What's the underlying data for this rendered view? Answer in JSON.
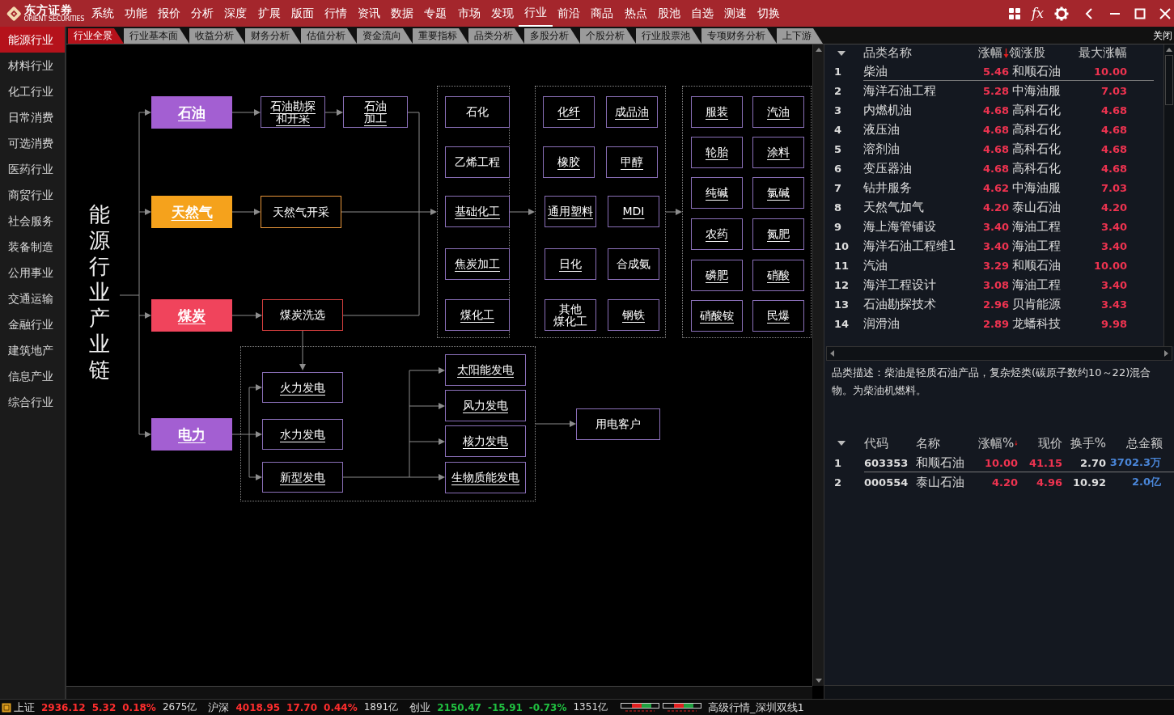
{
  "app": {
    "brand": "东方证券",
    "brand_en": "ORIENT SECURITIES"
  },
  "menu": [
    {
      "label": "系统",
      "selected": false
    },
    {
      "label": "功能",
      "selected": false
    },
    {
      "label": "报价",
      "selected": false
    },
    {
      "label": "分析",
      "selected": false
    },
    {
      "label": "深度",
      "selected": false
    },
    {
      "label": "扩展",
      "selected": false
    },
    {
      "label": "版面",
      "selected": false
    },
    {
      "label": "行情",
      "selected": false
    },
    {
      "label": "资讯",
      "selected": false
    },
    {
      "label": "数据",
      "selected": false
    },
    {
      "label": "专题",
      "selected": false
    },
    {
      "label": "市场",
      "selected": false
    },
    {
      "label": "发现",
      "selected": false
    },
    {
      "label": "行业",
      "selected": true
    },
    {
      "label": "前沿",
      "selected": false
    },
    {
      "label": "商品",
      "selected": false
    },
    {
      "label": "热点",
      "selected": false
    },
    {
      "label": "股池",
      "selected": false
    },
    {
      "label": "自选",
      "selected": false
    },
    {
      "label": "测速",
      "selected": false
    },
    {
      "label": "切换",
      "selected": false
    }
  ],
  "toolbar": {
    "formula_label": "fx"
  },
  "sidebar": {
    "items": [
      {
        "label": "能源行业",
        "selected": true
      },
      {
        "label": "材料行业",
        "selected": false
      },
      {
        "label": "化工行业",
        "selected": false
      },
      {
        "label": "日常消费",
        "selected": false
      },
      {
        "label": "可选消费",
        "selected": false
      },
      {
        "label": "医药行业",
        "selected": false
      },
      {
        "label": "商贸行业",
        "selected": false
      },
      {
        "label": "社会服务",
        "selected": false
      },
      {
        "label": "装备制造",
        "selected": false
      },
      {
        "label": "公用事业",
        "selected": false
      },
      {
        "label": "交通运输",
        "selected": false
      },
      {
        "label": "金融行业",
        "selected": false
      },
      {
        "label": "建筑地产",
        "selected": false
      },
      {
        "label": "信息产业",
        "selected": false
      },
      {
        "label": "综合行业",
        "selected": false
      }
    ]
  },
  "tabs": [
    {
      "label": "行业全景",
      "selected": true
    },
    {
      "label": "行业基本面",
      "selected": false
    },
    {
      "label": "收益分析",
      "selected": false
    },
    {
      "label": "财务分析",
      "selected": false
    },
    {
      "label": "估值分析",
      "selected": false
    },
    {
      "label": "资金流向",
      "selected": false
    },
    {
      "label": "重要指标",
      "selected": false
    },
    {
      "label": "品类分析",
      "selected": false
    },
    {
      "label": "多股分析",
      "selected": false
    },
    {
      "label": "个股分析",
      "selected": false
    },
    {
      "label": "行业股票池",
      "selected": false
    },
    {
      "label": "专项财务分析",
      "selected": false
    },
    {
      "label": "上下游",
      "selected": false
    }
  ],
  "close_label": "关闭",
  "diagram": {
    "title": "能源行业产业链",
    "nodes": [
      {
        "label": "石油",
        "kind": "source",
        "color": "#a35fd2",
        "linked": true
      },
      {
        "label": "石油勘探和开采",
        "kind": "box",
        "color": "#8a6fb8",
        "linked": true
      },
      {
        "label": "石油加工",
        "kind": "box",
        "color": "#8a6fb8",
        "linked": true
      },
      {
        "label": "天然气",
        "kind": "source",
        "color": "#f5a21c",
        "linked": true
      },
      {
        "label": "天然气开采",
        "kind": "box",
        "color": "#e8963a",
        "linked": false
      },
      {
        "label": "煤炭",
        "kind": "source",
        "color": "#f0445c",
        "linked": true
      },
      {
        "label": "煤炭洗选",
        "kind": "box",
        "color": "#d8403f",
        "linked": false
      },
      {
        "label": "电力",
        "kind": "source",
        "color": "#a35fd2",
        "linked": true
      },
      {
        "label": "石化",
        "kind": "box",
        "color": "#8a6fb8",
        "linked": false
      },
      {
        "label": "乙烯工程",
        "kind": "box",
        "color": "#8a6fb8",
        "linked": false
      },
      {
        "label": "基础化工",
        "kind": "box",
        "color": "#8a6fb8",
        "linked": true
      },
      {
        "label": "焦炭加工",
        "kind": "box",
        "color": "#8a6fb8",
        "linked": true
      },
      {
        "label": "煤化工",
        "kind": "box",
        "color": "#8a6fb8",
        "linked": true
      },
      {
        "label": "化纤",
        "kind": "box",
        "color": "#8a6fb8",
        "linked": true
      },
      {
        "label": "成品油",
        "kind": "box",
        "color": "#8a6fb8",
        "linked": true
      },
      {
        "label": "橡胶",
        "kind": "box",
        "color": "#8a6fb8",
        "linked": true
      },
      {
        "label": "甲醇",
        "kind": "box",
        "color": "#8a6fb8",
        "linked": true
      },
      {
        "label": "通用塑料",
        "kind": "box",
        "color": "#8a6fb8",
        "linked": true
      },
      {
        "label": "MDI",
        "kind": "box",
        "color": "#8a6fb8",
        "linked": true
      },
      {
        "label": "日化",
        "kind": "box",
        "color": "#8a6fb8",
        "linked": true
      },
      {
        "label": "合成氨",
        "kind": "box",
        "color": "#8a6fb8",
        "linked": false
      },
      {
        "label": "其他煤化工",
        "kind": "box",
        "color": "#8a6fb8",
        "linked": false
      },
      {
        "label": "钢铁",
        "kind": "box",
        "color": "#8a6fb8",
        "linked": true
      },
      {
        "label": "服装",
        "kind": "box",
        "color": "#8a6fb8",
        "linked": true
      },
      {
        "label": "汽油",
        "kind": "box",
        "color": "#8a6fb8",
        "linked": true
      },
      {
        "label": "轮胎",
        "kind": "box",
        "color": "#8a6fb8",
        "linked": true
      },
      {
        "label": "涂料",
        "kind": "box",
        "color": "#8a6fb8",
        "linked": true
      },
      {
        "label": "纯碱",
        "kind": "box",
        "color": "#8a6fb8",
        "linked": true
      },
      {
        "label": "氯碱",
        "kind": "box",
        "color": "#8a6fb8",
        "linked": true
      },
      {
        "label": "农药",
        "kind": "box",
        "color": "#8a6fb8",
        "linked": true
      },
      {
        "label": "氮肥",
        "kind": "box",
        "color": "#8a6fb8",
        "linked": true
      },
      {
        "label": "磷肥",
        "kind": "box",
        "color": "#8a6fb8",
        "linked": true
      },
      {
        "label": "硝酸",
        "kind": "box",
        "color": "#8a6fb8",
        "linked": true
      },
      {
        "label": "硝酸铵",
        "kind": "box",
        "color": "#8a6fb8",
        "linked": true
      },
      {
        "label": "民爆",
        "kind": "box",
        "color": "#8a6fb8",
        "linked": true
      },
      {
        "label": "火力发电",
        "kind": "box",
        "color": "#8a6fb8",
        "linked": true
      },
      {
        "label": "水力发电",
        "kind": "box",
        "color": "#8a6fb8",
        "linked": true
      },
      {
        "label": "新型发电",
        "kind": "box",
        "color": "#8a6fb8",
        "linked": true
      },
      {
        "label": "太阳能发电",
        "kind": "box",
        "color": "#8a6fb8",
        "linked": true
      },
      {
        "label": "风力发电",
        "kind": "box",
        "color": "#8a6fb8",
        "linked": true
      },
      {
        "label": "核力发电",
        "kind": "box",
        "color": "#8a6fb8",
        "linked": true
      },
      {
        "label": "生物质能发电",
        "kind": "box",
        "color": "#8a6fb8",
        "linked": true
      },
      {
        "label": "用电客户",
        "kind": "box",
        "color": "#8a6fb8",
        "linked": false
      }
    ]
  },
  "sector_table": {
    "columns": [
      {
        "label": "品类名称",
        "sorted": false
      },
      {
        "label": "涨幅",
        "sorted": true
      },
      {
        "label": "领涨股",
        "sorted": false
      },
      {
        "label": "最大涨幅",
        "sorted": false
      }
    ],
    "rows": [
      {
        "rank": "1",
        "name": "柴油",
        "change": "5.46",
        "leader": "和顺石油",
        "max_change": "10.00",
        "selected": true
      },
      {
        "rank": "2",
        "name": "海洋石油工程",
        "change": "5.28",
        "leader": "中海油服",
        "max_change": "7.03",
        "selected": false
      },
      {
        "rank": "3",
        "name": "内燃机油",
        "change": "4.68",
        "leader": "高科石化",
        "max_change": "4.68",
        "selected": false
      },
      {
        "rank": "4",
        "name": "液压油",
        "change": "4.68",
        "leader": "高科石化",
        "max_change": "4.68",
        "selected": false
      },
      {
        "rank": "5",
        "name": "溶剂油",
        "change": "4.68",
        "leader": "高科石化",
        "max_change": "4.68",
        "selected": false
      },
      {
        "rank": "6",
        "name": "变压器油",
        "change": "4.68",
        "leader": "高科石化",
        "max_change": "4.68",
        "selected": false
      },
      {
        "rank": "7",
        "name": "钻井服务",
        "change": "4.62",
        "leader": "中海油服",
        "max_change": "7.03",
        "selected": false
      },
      {
        "rank": "8",
        "name": "天然气加气",
        "change": "4.20",
        "leader": "泰山石油",
        "max_change": "4.20",
        "selected": false
      },
      {
        "rank": "9",
        "name": "海上海管铺设",
        "change": "3.40",
        "leader": "海油工程",
        "max_change": "3.40",
        "selected": false
      },
      {
        "rank": "10",
        "name": "海洋石油工程维1",
        "change": "3.40",
        "leader": "海油工程",
        "max_change": "3.40",
        "selected": false
      },
      {
        "rank": "11",
        "name": "汽油",
        "change": "3.29",
        "leader": "和顺石油",
        "max_change": "10.00",
        "selected": false
      },
      {
        "rank": "12",
        "name": "海洋工程设计",
        "change": "3.08",
        "leader": "海油工程",
        "max_change": "3.40",
        "selected": false
      },
      {
        "rank": "13",
        "name": "石油勘探技术",
        "change": "2.96",
        "leader": "贝肯能源",
        "max_change": "3.43",
        "selected": false
      },
      {
        "rank": "14",
        "name": "润滑油",
        "change": "2.89",
        "leader": "龙蟠科技",
        "max_change": "9.98",
        "selected": false
      }
    ]
  },
  "description": "品类描述：柴油是轻质石油产品，复杂烃类(碳原子数约10～22)混合物。为柴油机燃料。",
  "stock_table": {
    "columns": [
      {
        "label": "代码",
        "sorted": false
      },
      {
        "label": "名称",
        "sorted": false
      },
      {
        "label": "涨幅%",
        "sorted": true
      },
      {
        "label": "现价",
        "sorted": false
      },
      {
        "label": "换手%",
        "sorted": false
      },
      {
        "label": "总金额",
        "sorted": false
      }
    ],
    "rows": [
      {
        "rank": "1",
        "code": "603353",
        "name": "和顺石油",
        "change": "10.00",
        "price": "41.15",
        "turnover": "2.70",
        "amount": "3702.3万",
        "selected": true
      },
      {
        "rank": "2",
        "code": "000554",
        "name": "泰山石油",
        "change": "4.20",
        "price": "4.96",
        "turnover": "10.92",
        "amount": "2.0亿",
        "selected": false
      }
    ]
  },
  "status_bar": {
    "indices": [
      {
        "name": "上证",
        "value": "2936.12",
        "change": "5.32",
        "percent": "0.18%",
        "volume": "2675亿",
        "rising": true
      },
      {
        "name": "沪深",
        "value": "4018.95",
        "change": "17.70",
        "percent": "0.44%",
        "volume": "1891亿",
        "rising": true
      },
      {
        "name": "创业",
        "value": "2150.47",
        "change": "-15.91",
        "percent": "-0.73%",
        "volume": "1351亿",
        "rising": false
      }
    ],
    "connection": "高级行情_深圳双线1"
  }
}
